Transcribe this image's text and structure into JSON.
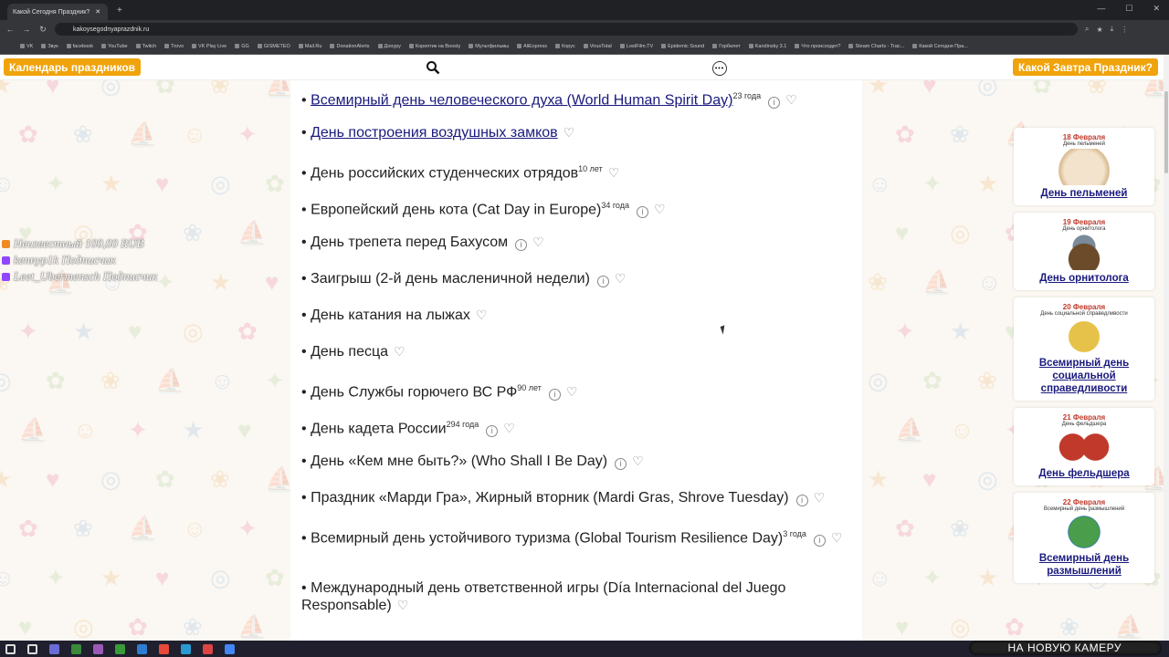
{
  "browser": {
    "tab_title": "Какой Сегодня Праздник?",
    "new_tab": "+",
    "url": "kakoysegodnyaprazdnik.ru",
    "bookmarks": [
      "VK",
      "Звук",
      "facebook",
      "YouTube",
      "Twitch",
      "Trovo",
      "VK Play Live",
      "GG",
      "GISMETEO",
      "Mail.Ru",
      "DonationAlerts",
      "Донуру",
      "Корептик на Boosty",
      "Мультфильмы",
      "AliExpress",
      "Корус",
      "VirusTotal",
      "LostFilm.TV",
      "Epidemic Sound",
      "Горбилет",
      "Kandinsky 3.1",
      "Что происходит?",
      "Steam Charts - Trac...",
      "Какой Сегодня Пра..."
    ]
  },
  "header": {
    "calendar_button": "Календарь праздников",
    "tomorrow_button": "Какой Завтра Праздник?",
    "more_icon_glyph": "•••"
  },
  "holidays": [
    {
      "name": "Всемирный день человеческого духа (World Human Spirit Day)",
      "link": true,
      "years": "23 года",
      "info": true
    },
    {
      "name": "День построения воздушных замков",
      "link": true,
      "years": "",
      "info": false
    },
    {
      "name": "День российских студенческих отрядов",
      "link": false,
      "years": "10 лет",
      "info": false
    },
    {
      "name": "Европейский день кота (Cat Day in Europe)",
      "link": false,
      "years": "34 года",
      "info": true
    },
    {
      "name": "День трепета перед Бахусом",
      "link": false,
      "years": "",
      "info": true
    },
    {
      "name": "Заигрыш (2-й день масленичной недели)",
      "link": false,
      "years": "",
      "info": true
    },
    {
      "name": "День катания на лыжах",
      "link": false,
      "years": "",
      "info": false
    },
    {
      "name": "День песца",
      "link": false,
      "years": "",
      "info": false
    },
    {
      "name": "День Службы горючего ВС РФ",
      "link": false,
      "years": "90 лет",
      "info": true
    },
    {
      "name": "День кадета России",
      "link": false,
      "years": "294 года",
      "info": true
    },
    {
      "name": "День «Кем мне быть?» (Who Shall I Be Day)",
      "link": false,
      "years": "",
      "info": true
    },
    {
      "name": "Праздник «Марди Гра», Жирный вторник (Mardi Gras, Shrove Tuesday)",
      "link": false,
      "years": "",
      "info": true
    },
    {
      "name": "Всемирный день устойчивого туризма (Global Tourism Resilience Day)",
      "link": false,
      "years": "3 года",
      "info": true
    },
    {
      "name": "Международный день ответственной игры (Día Internacional del Juego Responsable)",
      "link": false,
      "years": "",
      "info": false
    }
  ],
  "bullet": "•",
  "info_glyph": "i",
  "heart_glyph": "♡",
  "overlay": [
    {
      "text": "Неизвестный 100,00 RUB",
      "color": "#f08a24"
    },
    {
      "text": "kennyp1k Подписчик",
      "color": "#9146ff"
    },
    {
      "text": "Leet_Ubermensch Подписчик",
      "color": "#9146ff"
    }
  ],
  "sidebar": [
    {
      "date": "18 Февраля",
      "caption": "День пельменей",
      "title": "День пельменей",
      "icon": "dumplings-image"
    },
    {
      "date": "19 Февраля",
      "caption": "День орнитолога",
      "title": "День орнитолога",
      "icon": "bird-nest-image"
    },
    {
      "date": "20 Февраля",
      "caption": "День социальной справедливости",
      "title": "Всемирный день социальной справедливости",
      "icon": "scales-image"
    },
    {
      "date": "21 Февраля",
      "caption": "День фельдшера",
      "title": "День фельдшера",
      "icon": "paramedics-image"
    },
    {
      "date": "22 Февраля",
      "caption": "Всемирный день размышлений",
      "title": "Всемирный день размышлений",
      "icon": "world-thinking-day-image"
    }
  ],
  "camera_banner": "НА НОВУЮ КАМЕРУ"
}
